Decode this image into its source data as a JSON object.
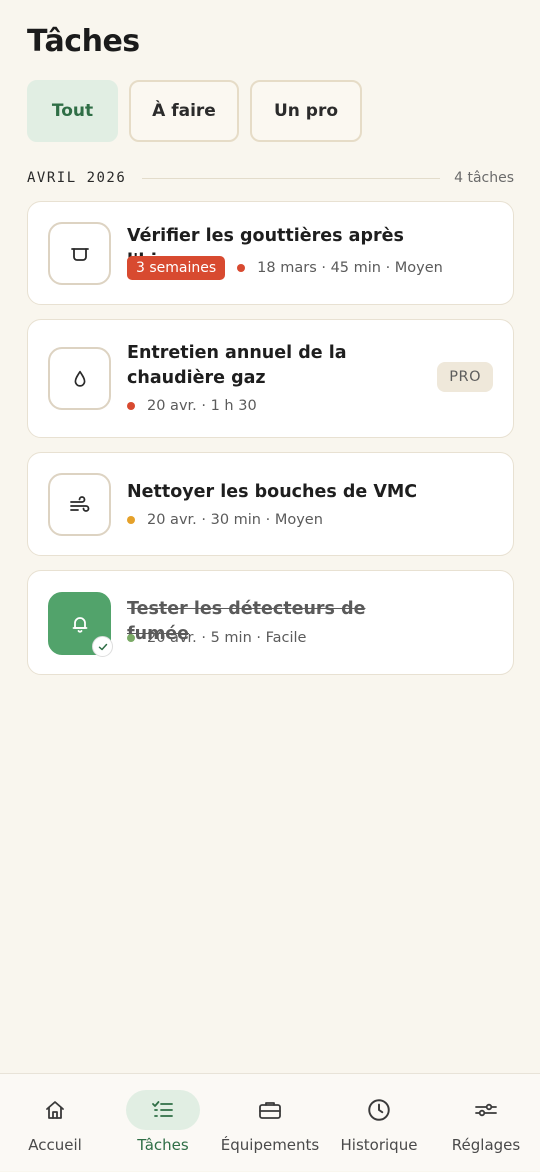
{
  "header": {
    "title": "Tâches"
  },
  "filters": [
    {
      "label": "Tout",
      "active": true
    },
    {
      "label": "À faire",
      "active": false
    },
    {
      "label": "Un pro",
      "active": false
    }
  ],
  "section": {
    "label": "AVRIL 2026",
    "count": "4 tâches"
  },
  "tasks": [
    {
      "title": "Vérifier les gouttières après l'hiver",
      "icon": "gutter-icon",
      "badge": "3 semaines",
      "meta": "18 mars · 45 min · Moyen",
      "dot_color": "#d84a30",
      "done": false
    },
    {
      "title": "Entretien annuel de la chaudière gaz",
      "icon": "drop-icon",
      "tag": "PRO",
      "meta": "20 avr. · 1 h 30",
      "dot_color": "#d84a30",
      "done": false
    },
    {
      "title": "Nettoyer les bouches de VMC",
      "icon": "wind-icon",
      "meta": "20 avr. · 30 min · Moyen",
      "dot_color": "#e5a12a",
      "done": false
    },
    {
      "title": "Tester les détecteurs de fumée",
      "icon": "bell-icon",
      "meta": "20 avr. · 5 min · Facile",
      "dot_color": "#7aaa66",
      "done": true
    }
  ],
  "nav": [
    {
      "label": "Accueil",
      "icon": "home-icon",
      "active": false
    },
    {
      "label": "Tâches",
      "icon": "checklist-icon",
      "active": true
    },
    {
      "label": "Équipements",
      "icon": "toolbox-icon",
      "active": false
    },
    {
      "label": "Historique",
      "icon": "clock-icon",
      "active": false
    },
    {
      "label": "Réglages",
      "icon": "sliders-icon",
      "active": false
    }
  ],
  "colors": {
    "background": "#f9f6ee",
    "accent_green": "#2f6e46",
    "accent_green_bg": "#e1eee3",
    "overdue_red": "#d84a30",
    "done_green": "#52a36b"
  }
}
